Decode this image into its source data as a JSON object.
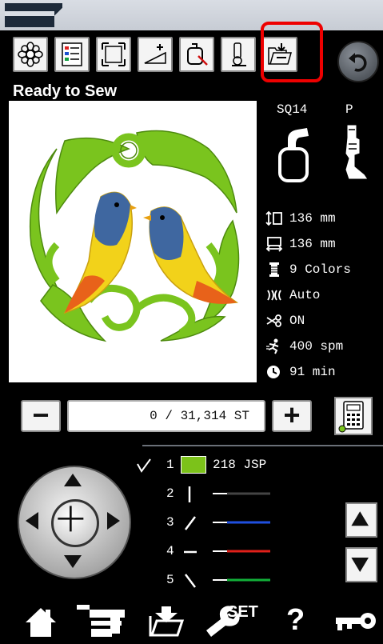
{
  "status": "Ready to Sew",
  "hoop": {
    "code": "SQ14",
    "foot": "P"
  },
  "info": {
    "height": "136 mm",
    "width": "136 mm",
    "colors": "9 Colors",
    "thread_cut_mode": "Auto",
    "trim": "ON",
    "speed": "400 spm",
    "time": "91 min"
  },
  "stitch": {
    "counter": "0 / 31,314 ST",
    "minus": "−",
    "plus": "+"
  },
  "color_list": [
    {
      "n": "1",
      "label": "218 JSP",
      "color": "#7cc21a",
      "current": true
    },
    {
      "n": "2",
      "label": "",
      "color": "#444444"
    },
    {
      "n": "3",
      "label": "",
      "color": "#1f4fe0"
    },
    {
      "n": "4",
      "label": "",
      "color": "#e0201a"
    },
    {
      "n": "5",
      "label": "",
      "color": "#12b03a"
    }
  ],
  "bottom_nav": {
    "set_label": "SET",
    "help_label": "?"
  },
  "icons": {
    "toolbar": [
      "flower-pattern-icon",
      "color-list-icon",
      "resize-icon",
      "slope-plus-icon",
      "hoop-trace-icon",
      "presser-foot-icon",
      "save-folder-icon"
    ],
    "back": "back-arrow-icon"
  },
  "colors": {
    "highlight": "#e00000",
    "background": "#000000"
  }
}
